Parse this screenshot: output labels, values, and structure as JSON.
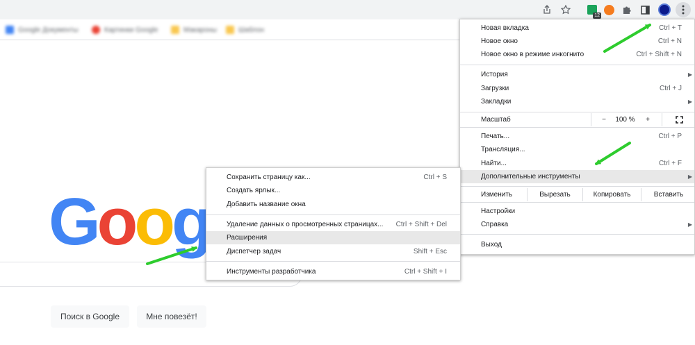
{
  "toolbar": {
    "icons": [
      "share-icon",
      "star-icon",
      "extension-badge-icon",
      "ahrefs-icon",
      "puzzle-icon",
      "sidepanel-icon",
      "avatar",
      "kebab-menu-icon"
    ],
    "extension_badge_count": "12"
  },
  "bookmarks": [
    "Google Документы",
    "Картинки Google",
    "Макароны",
    "Шаблон"
  ],
  "google": {
    "search_button": "Поиск в Google",
    "lucky_button": "Мне повезёт!"
  },
  "chrome_menu": {
    "group1": [
      {
        "label": "Новая вкладка",
        "shortcut": "Ctrl + T"
      },
      {
        "label": "Новое окно",
        "shortcut": "Ctrl + N"
      },
      {
        "label": "Новое окно в режиме инкогнито",
        "shortcut": "Ctrl + Shift + N"
      }
    ],
    "group2": [
      {
        "label": "История",
        "shortcut": ""
      },
      {
        "label": "Загрузки",
        "shortcut": "Ctrl + J"
      },
      {
        "label": "Закладки",
        "shortcut": ""
      }
    ],
    "zoom": {
      "label": "Масштаб",
      "minus": "−",
      "value": "100 %",
      "plus": "+"
    },
    "group3": [
      {
        "label": "Печать...",
        "shortcut": "Ctrl + P"
      },
      {
        "label": "Трансляция...",
        "shortcut": ""
      },
      {
        "label": "Найти...",
        "shortcut": "Ctrl + F"
      },
      {
        "label": "Дополнительные инструменты",
        "shortcut": ""
      }
    ],
    "edit": {
      "label": "Изменить",
      "cut": "Вырезать",
      "copy": "Копировать",
      "paste": "Вставить"
    },
    "group4": [
      {
        "label": "Настройки",
        "shortcut": ""
      },
      {
        "label": "Справка",
        "shortcut": ""
      }
    ],
    "exit": {
      "label": "Выход"
    }
  },
  "submenu": {
    "group1": [
      {
        "label": "Сохранить страницу как...",
        "shortcut": "Ctrl + S"
      },
      {
        "label": "Создать ярлык...",
        "shortcut": ""
      },
      {
        "label": "Добавить название окна",
        "shortcut": ""
      }
    ],
    "group2": [
      {
        "label": "Удаление данных о просмотренных страницах...",
        "shortcut": "Ctrl + Shift + Del"
      },
      {
        "label": "Расширения",
        "shortcut": ""
      },
      {
        "label": "Диспетчер задач",
        "shortcut": "Shift + Esc"
      }
    ],
    "group3": [
      {
        "label": "Инструменты разработчика",
        "shortcut": "Ctrl + Shift + I"
      }
    ]
  },
  "colors": {
    "arrow": "#2ecc2e",
    "highlight": "#e8e8e8",
    "google_blue": "#4285f4",
    "google_red": "#ea4335",
    "google_yellow": "#fbbc05",
    "google_green": "#34a853"
  }
}
